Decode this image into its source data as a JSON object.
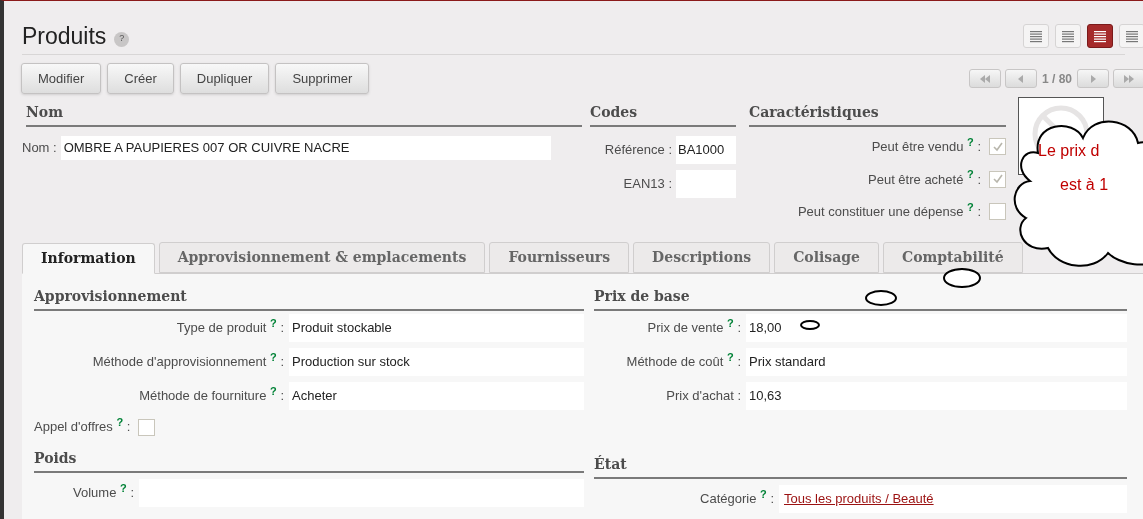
{
  "title": "Produits",
  "title_help": "?",
  "view_switcher": [
    {
      "selected": false
    },
    {
      "selected": false
    },
    {
      "selected": true
    },
    {
      "selected": false
    }
  ],
  "buttons": [
    "Modifier",
    "Créer",
    "Dupliquer",
    "Supprimer"
  ],
  "pager": {
    "text": "1 / 80"
  },
  "nom": {
    "heading": "Nom",
    "label": "Nom :",
    "value": "OMBRE A PAUPIERES 007 OR CUIVRE NACRE"
  },
  "codes": {
    "heading": "Codes",
    "fields": [
      {
        "label": "Référence :",
        "value": "BA1000"
      },
      {
        "label": "EAN13 :"
      }
    ]
  },
  "caracteristiques": {
    "heading": "Caractéristiques",
    "items": [
      {
        "label": "Peut être vendu $^{?}$ :",
        "checked": true
      },
      {
        "label": "Peut être acheté $^{?}$ :",
        "checked": true
      },
      {
        "label": "Peut constituer une dépense $^{?}$ :",
        "checked": false
      }
    ]
  },
  "tabs": [
    {
      "label": "Information",
      "selected": true
    },
    {
      "label": "Approvisionnement & emplacements",
      "selected": false
    },
    {
      "label": "Fournisseurs",
      "selected": false
    },
    {
      "label": "Descriptions",
      "selected": false
    },
    {
      "label": "Colisage",
      "selected": false
    },
    {
      "label": "Comptabilité",
      "selected": false
    }
  ],
  "approvisionnement": {
    "heading": "Approvisionnement",
    "fields": [
      {
        "label": "Type de produit $^{?}$ :",
        "value": "Produit stockable"
      },
      {
        "label": "Méthode d'approvisionnement $^{?}$ :",
        "value": "Production sur stock"
      },
      {
        "label": "Méthode de fourniture $^{?}$ :",
        "value": "Acheter"
      }
    ],
    "appel_offres": {
      "label": "Appel d'offres $^{?}$ :",
      "checked": false
    }
  },
  "prix_de_base": {
    "heading": "Prix de base",
    "fields": [
      {
        "label": "Prix de vente $^{?}$ :",
        "value": "18,00"
      },
      {
        "label": "Méthode de coût $^{?}$ :",
        "value": "Prix standard"
      },
      {
        "label": "Prix d'achat :",
        "value": "10,63"
      }
    ]
  },
  "poids": {
    "heading": "Poids",
    "fields": [
      {
        "label": "Volume $^{?}$ :"
      }
    ]
  },
  "etat": {
    "heading": "État",
    "fields": [
      {
        "label": "Catégorie $^{?}$ :",
        "link": "Tous les produits / Beauté"
      }
    ]
  },
  "callout": {
    "lines": [
      "Le prix d",
      "est à 1"
    ]
  }
}
